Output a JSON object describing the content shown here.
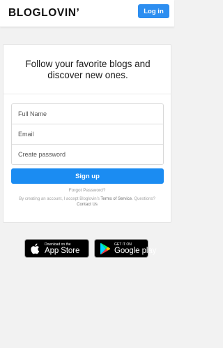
{
  "header": {
    "logo_text": "BLOGLOVIN’",
    "login_label": "Log in"
  },
  "signup_card": {
    "headline": "Follow your favorite blogs and discover new ones.",
    "fields": {
      "full_name_placeholder": "Full Name",
      "email_placeholder": "Email",
      "password_placeholder": "Create password"
    },
    "signup_label": "Sign up",
    "forgot_password": "Forgot Password?",
    "legal": {
      "prefix": "By creating an account, I accept Bloglovin’s ",
      "terms_link": "Terms of Service",
      "questions_prefix": ". Questions? ",
      "contact_link": "Contact Us"
    }
  },
  "app_badges": {
    "apple": {
      "small_text": "Download on the",
      "big_text": "App Store",
      "icon": "apple-logo-icon"
    },
    "google": {
      "small_text": "GET IT ON",
      "big_text": "Google play",
      "icon": "google-play-logo-icon"
    }
  },
  "colors": {
    "primary_blue": "#1b8cf2",
    "login_blue": "#2d8ef0",
    "page_background": "#f2f2f2"
  }
}
